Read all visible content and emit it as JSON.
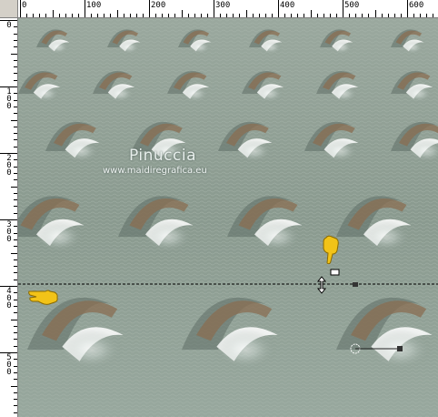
{
  "rulers": {
    "horizontal_labels": [
      "0",
      "100",
      "200",
      "300",
      "400",
      "500",
      "600"
    ],
    "vertical_labels": [
      [
        "0"
      ],
      [
        "1",
        "0",
        "0"
      ],
      [
        "2",
        "0",
        "0"
      ],
      [
        "3",
        "0",
        "0"
      ],
      [
        "4",
        "0",
        "0"
      ],
      [
        "5",
        "0",
        "0"
      ]
    ],
    "unit": "px"
  },
  "canvas": {
    "watermark_name": "Pinuccia",
    "watermark_url": "www.maidiregrafica.eu"
  },
  "colors": {
    "pointer_hand": "#f2c318",
    "guide_line": "#000000",
    "background_tone": "#8c9c90"
  }
}
